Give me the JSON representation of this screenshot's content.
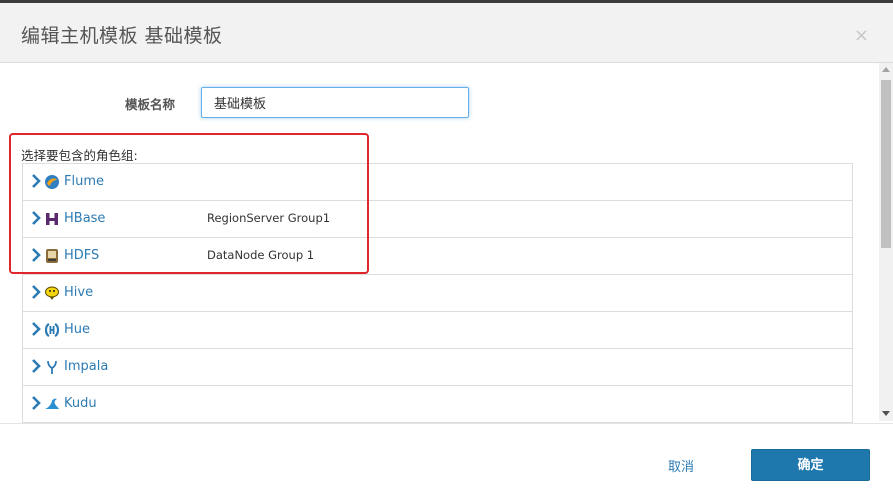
{
  "dialog": {
    "title": "编辑主机模板 基础模板",
    "close_label": "×"
  },
  "form": {
    "name_label": "模板名称",
    "name_value": "基础模板"
  },
  "roles": {
    "section_label": "选择要包含的角色组:",
    "items": [
      {
        "service": "Flume",
        "icon": "flume-icon",
        "group": ""
      },
      {
        "service": "HBase",
        "icon": "hbase-icon",
        "group": "RegionServer Group1"
      },
      {
        "service": "HDFS",
        "icon": "hdfs-icon",
        "group": "DataNode Group 1"
      },
      {
        "service": "Hive",
        "icon": "hive-icon",
        "group": ""
      },
      {
        "service": "Hue",
        "icon": "hue-icon",
        "group": ""
      },
      {
        "service": "Impala",
        "icon": "impala-icon",
        "group": ""
      },
      {
        "service": "Kudu",
        "icon": "kudu-icon",
        "group": ""
      }
    ]
  },
  "footer": {
    "cancel_label": "取消",
    "ok_label": "确定"
  },
  "colors": {
    "link": "#2c7bb4",
    "primary_button": "#1f78ad",
    "highlight": "#e0262b"
  }
}
